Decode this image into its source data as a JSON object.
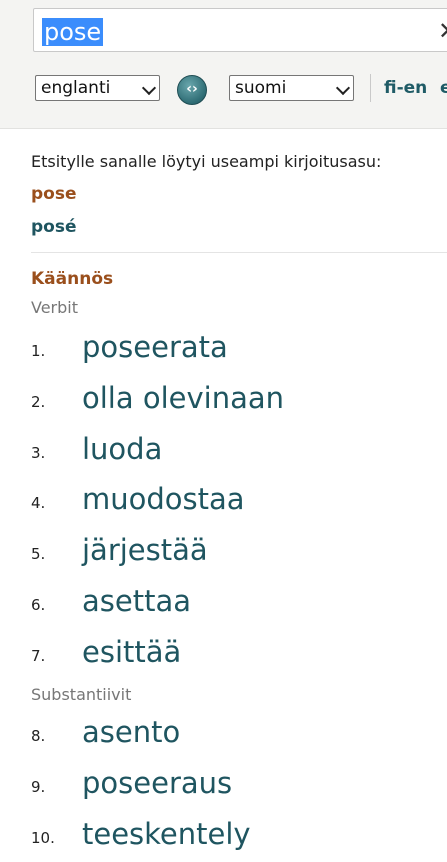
{
  "search": {
    "query": "pose",
    "clear_icon": "close-icon"
  },
  "languages": {
    "source": "englanti",
    "target": "suomi",
    "swap_icon": "swap-icon",
    "swap_glyph": "‹›",
    "pair": "fi-en",
    "next_pair_partial": "e"
  },
  "spelling": {
    "notice": "Etsitylle sanalle löytyi useampi kirjoitusasu:",
    "options": [
      "pose",
      "posé"
    ]
  },
  "translation": {
    "heading": "Käännös",
    "groups": [
      {
        "pos": "Verbit",
        "items": [
          {
            "n": "1.",
            "text": "poseerata"
          },
          {
            "n": "2.",
            "text": "olla olevinaan"
          },
          {
            "n": "3.",
            "text": "luoda"
          },
          {
            "n": "4.",
            "text": "muodostaa"
          },
          {
            "n": "5.",
            "text": "järjestää"
          },
          {
            "n": "6.",
            "text": "asettaa"
          },
          {
            "n": "7.",
            "text": "esittää"
          }
        ]
      },
      {
        "pos": "Substantiivit",
        "items": [
          {
            "n": "8.",
            "text": "asento"
          },
          {
            "n": "9.",
            "text": "poseeraus"
          },
          {
            "n": "10.",
            "text": "teeskentely"
          }
        ]
      }
    ]
  },
  "colors": {
    "accent_brown": "#9a4f1c",
    "accent_teal": "#1f5560",
    "selection": "#3b8dfc"
  }
}
